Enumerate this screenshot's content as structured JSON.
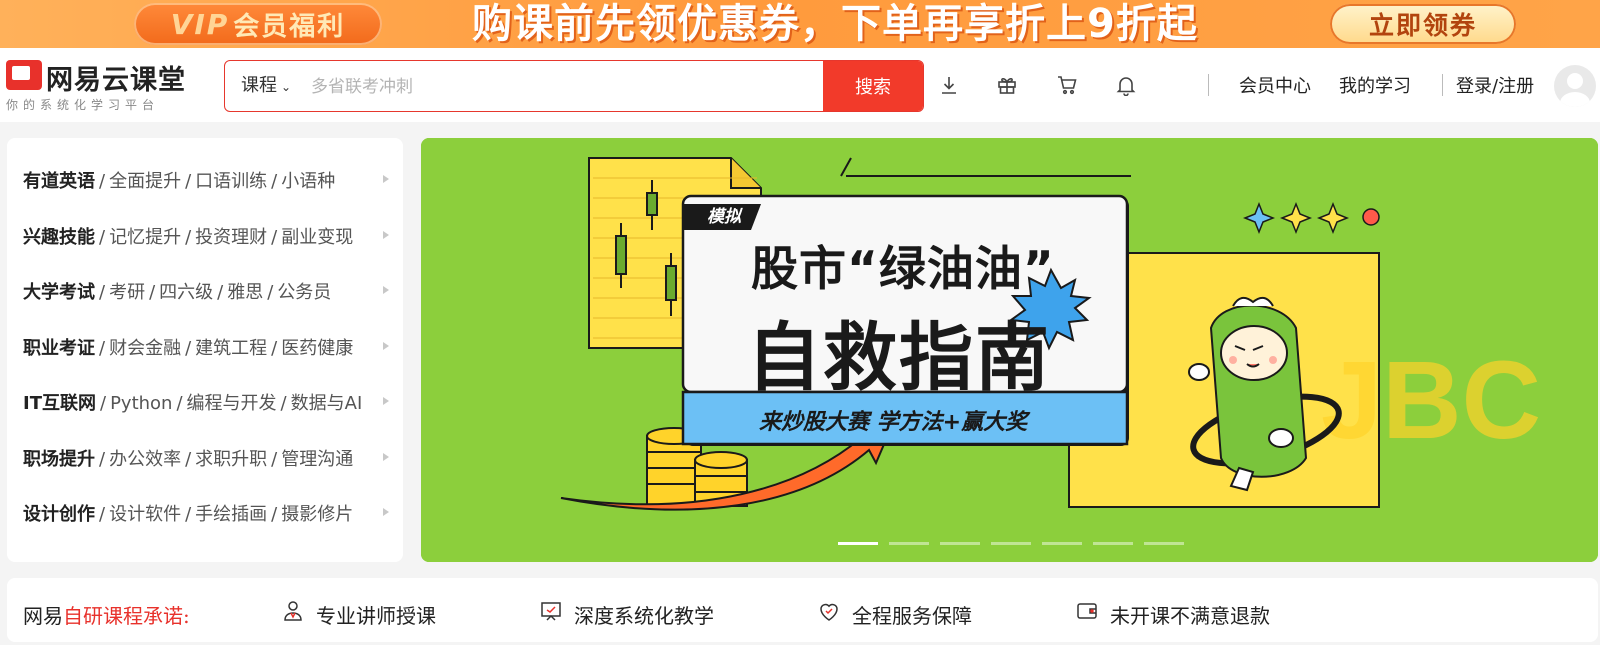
{
  "promo": {
    "vip_mark": "VIP",
    "vip_label": "会员福利",
    "text": "购课前先领优惠券，下单再享折上9折起",
    "cta": "立即领券"
  },
  "header": {
    "logo_name": "网易云课堂",
    "logo_slogan": "你的系统化学习平台",
    "search": {
      "category": "课程",
      "placeholder": "多省联考冲刺",
      "button": "搜索"
    },
    "icons": [
      "download-icon",
      "gift-icon",
      "cart-icon",
      "bell-icon"
    ],
    "links": {
      "member_center": "会员中心",
      "my_learning": "我的学习",
      "login": "登录/注册"
    }
  },
  "categories": [
    {
      "title": "有道英语",
      "subs": [
        "全面提升",
        "口语训练",
        "小语种"
      ]
    },
    {
      "title": "兴趣技能",
      "subs": [
        "记忆提升",
        "投资理财",
        "副业变现"
      ]
    },
    {
      "title": "大学考试",
      "subs": [
        "考研",
        "四六级",
        "雅思",
        "公务员"
      ]
    },
    {
      "title": "职业考证",
      "subs": [
        "财会金融",
        "建筑工程",
        "医药健康"
      ]
    },
    {
      "title": "IT互联网",
      "subs": [
        "Python",
        "编程与开发",
        "数据与AI"
      ]
    },
    {
      "title": "职场提升",
      "subs": [
        "办公效率",
        "求职升职",
        "管理沟通"
      ]
    },
    {
      "title": "设计创作",
      "subs": [
        "设计软件",
        "手绘插画",
        "摄影修片"
      ]
    }
  ],
  "hero": {
    "tag": "模拟",
    "headline_1": "股市“绿油油”",
    "headline_2": "自救指南",
    "subline": "来炒股大赛  学方法+赢大奖",
    "slide_count": 7,
    "active_slide": 1,
    "colors": {
      "background": "#8ccf3c",
      "yellow": "#ffe14a",
      "blue": "#6cc0f5",
      "orange": "#ff6a2a"
    }
  },
  "promise": {
    "prefix": "网易",
    "title_red": "自研课程承诺:",
    "items": [
      {
        "icon": "teacher-icon",
        "label": "专业讲师授课"
      },
      {
        "icon": "board-icon",
        "label": "深度系统化教学"
      },
      {
        "icon": "heart-shield-icon",
        "label": "全程服务保障"
      },
      {
        "icon": "wallet-icon",
        "label": "未开课不满意退款"
      }
    ]
  }
}
